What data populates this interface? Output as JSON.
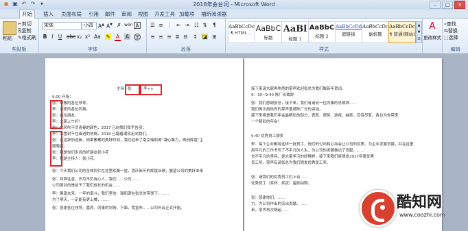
{
  "window": {
    "title": "2018年会台词 - Microsoft Word"
  },
  "tabs": [
    "开始",
    "插入",
    "页面布局",
    "引用",
    "邮件",
    "审阅",
    "视图",
    "开发工具",
    "加载项",
    "福昕阅读器"
  ],
  "ribbon": {
    "clipboard": {
      "label": "剪贴板",
      "paste": "粘贴",
      "cut": "剪切",
      "copy": "复制",
      "format_painter": "格式刷"
    },
    "font": {
      "label": "字体",
      "font_name": "宋体",
      "font_size": "小四",
      "wen_glyph": "wén",
      "a_glyph": "A"
    },
    "paragraph": {
      "label": "段落"
    },
    "styles": {
      "label": "样式",
      "items": [
        {
          "preview": "AaBbCcDc",
          "name": "¶ HTML ..."
        },
        {
          "preview": "AaBbC",
          "name": "标题"
        },
        {
          "preview": "AaBl",
          "name": "标题 1"
        },
        {
          "preview": "AaBbC",
          "name": "标题 2"
        },
        {
          "preview": "AaBbCcDd",
          "name": "超链接"
        },
        {
          "preview": "AaBbCcDc",
          "name": "副标题"
        },
        {
          "preview": "AaBbCcDc",
          "name": "¶ 普通(网站)"
        }
      ],
      "change_styles": "更改样式"
    },
    "editing": {
      "label": "编辑",
      "find": "查找",
      "replace": "替换",
      "select": "选择"
    }
  },
  "left_page": {
    "header_label": "主持：",
    "header_box1": "张",
    "header_box2": "李××",
    "lines": [
      "9:00 开场：",
      "张：尊敬的各位领导，",
      "李：亲爱的各位同事，",
      "张：各位朋友，",
      "李：大家上午好！",
      "张：北风吹不尽青春的颜色，2017 已向我们挥手告别；",
      "李：冰雪封不住奋进的热情，2018 已踏着潮流走向我们。",
      "张：在这辞旧迎新、硕果累累的美好时刻，我们迎来了南京瑞和源“凝心聚力，再创辉煌”主",
      "题晚宴。",
      "张：我是你们永远的好朋友张小花",
      "李：我是主持人：张小花。",
      "",
      "张：今天我们公司的全体同仁在这里欢聚一堂，喜庆新年的辉煌业绩，展望公司的美好未来",
      "张：回首往昔，岁月不负有心人，我们……公司……",
      "公司面对的是给予了我们成长的机会……",
      "李：展望未来，一年的奋斗，我们坚信：瑞和源在张总的带领下，……",
      "为了明天，一定能有更上楼，……",
      "张：感谢各位领导、嘉宾、同事的到场，下面，我宣布……公司年会正式开始。"
    ]
  },
  "right_page": {
    "lines": [
      "接下来请大家再热烈的掌声欢迎张总为我们致新年贺词。",
      "9：30~9:40  陈厂长致辞",
      "张：我们感谢张总，接下来，我们有请另一位同事的总致辞……",
      "我们再次用热烈的掌声邀请陈厂长的讲话。",
      "接下来将是我们年会最精彩的部分，表彰、颁奖、游戏、抽奖，应有尽有，各位为你带来",
      "一个精彩的年会！",
      "",
      "9:40  优秀员工颁奖",
      "李：每个企业都有这样一批员工，他们的付出和心血会让公司的优质、为企业发展贡献，并在这里",
      "用平凡的工作书写了不平凡的人生，为公司的发展做出了贡献，……",
      "也不平凡的坚持，是大家学习的好榜样，接下来我们将颁发2017年度优秀",
      "员工奖，掌声有请张总为我们颁发优秀员工奖。",
      "",
      "张：请我们的优秀员工们上台……",
      "优秀员工（奖杯、奖状）留影拍照。",
      "",
      "张：感谢你们，……",
      "力，为公司作出的突出贡献。……",
      "来，掌声再次响起……"
    ]
  },
  "watermark": {
    "name": "酷知网",
    "url": "www.coozhi.com"
  }
}
